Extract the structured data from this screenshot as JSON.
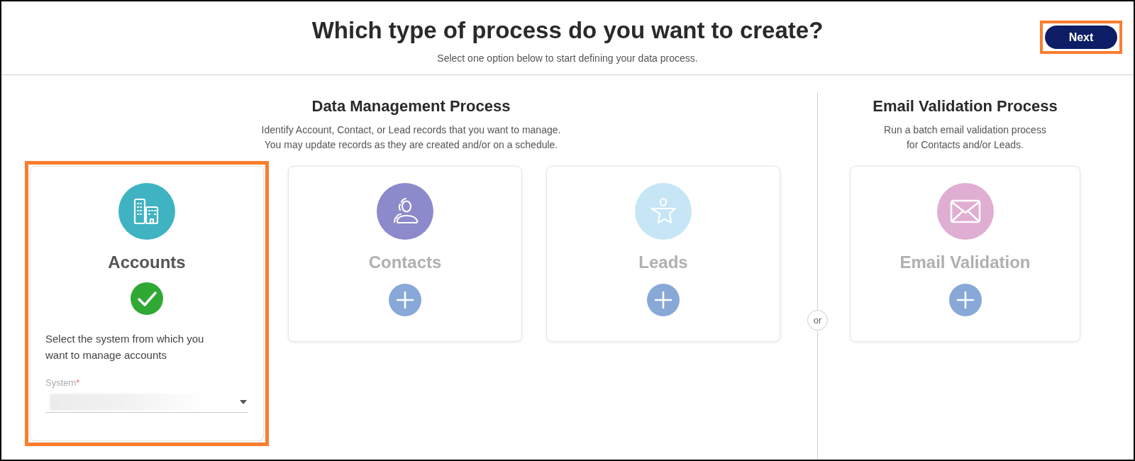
{
  "header": {
    "title": "Which type of process do you want to create?",
    "subtitle": "Select one option below to start defining your data process.",
    "next_button": {
      "label": "Next",
      "highlighted": true
    }
  },
  "sections": [
    {
      "title": "Data Management Process",
      "description_lines": [
        "Identify Account, Contact, or Lead records that you want to manage.",
        "You may update records as they are created and/or on a schedule."
      ],
      "cards": [
        {
          "kind": "accounts",
          "label": "Accounts",
          "color": "#3fb3c2",
          "selected": true,
          "prompt": "Select the system from which you want to manage accounts",
          "field": {
            "label": "System",
            "required_mark": "*"
          }
        },
        {
          "kind": "contacts",
          "label": "Contacts",
          "color": "#8c8aca",
          "selected": false
        },
        {
          "kind": "leads",
          "label": "Leads",
          "color": "#c6e6f5",
          "selected": false
        }
      ]
    },
    {
      "title": "Email Validation Process",
      "description_lines": [
        "Run a batch email validation process",
        "for Contacts and/or Leads."
      ],
      "cards": [
        {
          "kind": "email",
          "label": "Email Validation",
          "color": "#e0aed2",
          "selected": false
        }
      ]
    }
  ],
  "separator": "or"
}
